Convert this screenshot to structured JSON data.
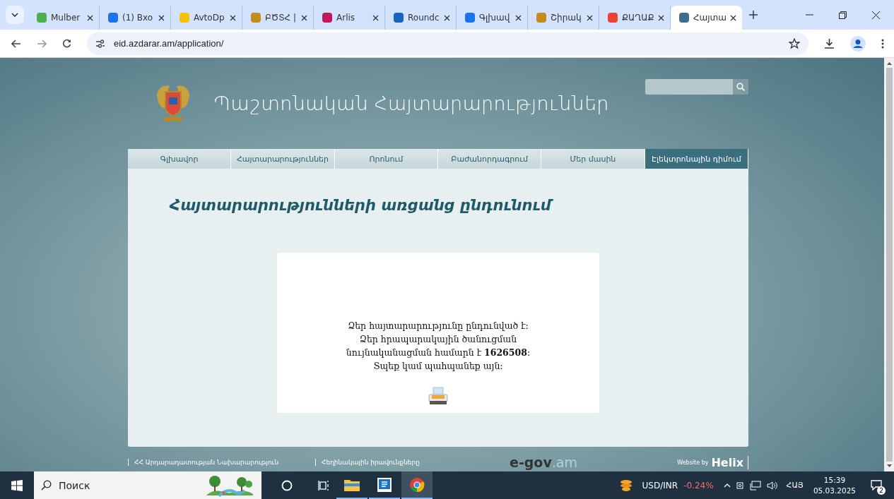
{
  "browser": {
    "tabs": [
      {
        "title": "Mulber",
        "selected": false
      },
      {
        "title": "(1) Bxo",
        "selected": false
      },
      {
        "title": "AvtoDp",
        "selected": false
      },
      {
        "title": "ԲԾՏՀ |",
        "selected": false
      },
      {
        "title": "Arlis",
        "selected": false
      },
      {
        "title": "Roundc",
        "selected": false
      },
      {
        "title": "Գլխավ",
        "selected": false
      },
      {
        "title": "Շիրակ",
        "selected": false
      },
      {
        "title": "ՔԱՂԱՔ",
        "selected": false
      },
      {
        "title": "Հայտա",
        "selected": true
      }
    ],
    "url": "eid.azdarar.am/application/"
  },
  "page": {
    "site_title": "Պաշտոնական Հայտարարություններ",
    "nav": [
      {
        "label": "Գլխավոր",
        "selected": false
      },
      {
        "label": "Հայտարարություններ",
        "selected": false
      },
      {
        "label": "Որոնում",
        "selected": false
      },
      {
        "label": "Բաժանորդագրում",
        "selected": false
      },
      {
        "label": "Մեր մասին",
        "selected": false
      },
      {
        "label": "Էլեկտրոնային դիմում",
        "selected": true
      }
    ],
    "heading": "Հայտարարությունների առցանց ընդունում",
    "message": [
      "Ձեր հայտարարությունը ընդունված է:",
      "Ձեր հրապարակային ծանուցման",
      "նույնականացման համարն է **1626508**:",
      "Տպեք կամ պահպանեք այն:"
    ],
    "footer": {
      "links": [
        "ՀՀ Արդարադատության Նախարարություն",
        "Հեղինակային իրավունքները"
      ],
      "egov": "e-gov",
      "egov_suffix": ".am",
      "credit": "Website by",
      "credit_brand": "Helix"
    }
  },
  "taskbar": {
    "search_placeholder": "Поиск",
    "ticker": "USD/INR",
    "change": "-0.24%",
    "language": "ՀԱՅ",
    "time": "15:39",
    "date": "05.03.2025",
    "notifications": "2"
  }
}
